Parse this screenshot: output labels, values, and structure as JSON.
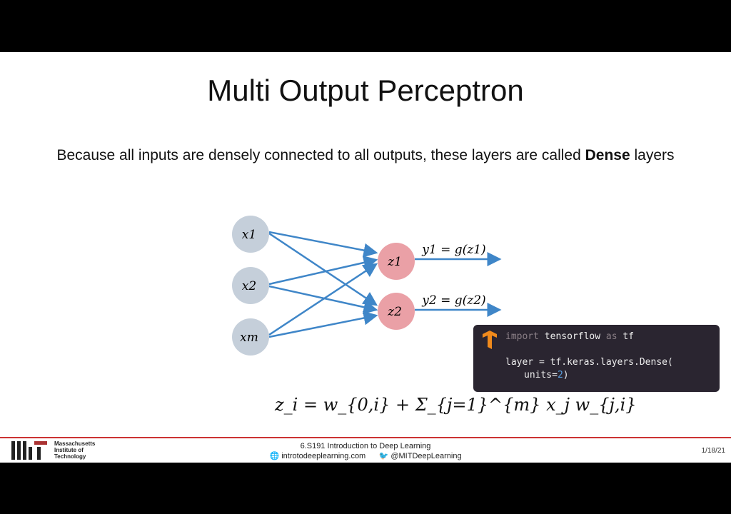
{
  "title": "Multi Output Perceptron",
  "subtitle_pre": "Because all inputs are densely connected to all outputs, these layers are called ",
  "subtitle_bold": "Dense",
  "subtitle_post": " layers",
  "nodes": {
    "inputs": [
      "x1",
      "x2",
      "xm"
    ],
    "outputs": [
      "z1",
      "z2"
    ]
  },
  "output_labels": [
    "y1 = g(z1)",
    "y2 = g(z2)"
  ],
  "equation": "z_i = w_{0,i} + Σ_{j=1}^{m} x_j w_{j,i}",
  "code": {
    "line1_kw": "import",
    "line1_mod": "tensorflow",
    "line1_as": "as",
    "line1_alias": "tf",
    "line2": "layer = tf.keras.layers.Dense(",
    "line3_pre": "units=",
    "line3_num": "2",
    "line3_post": ")"
  },
  "footer": {
    "institution": "Massachusetts Institute of Technology",
    "course": "6.S191 Introduction to Deep Learning",
    "website": "introtodeeplearning.com",
    "twitter": "@MITDeepLearning",
    "date": "1/18/21"
  },
  "colors": {
    "input_node": "#c5cfda",
    "output_node": "#eaa0a6",
    "arrow": "#3f86c8",
    "code_bg": "#2a2530",
    "footer_line": "#cc3333"
  }
}
